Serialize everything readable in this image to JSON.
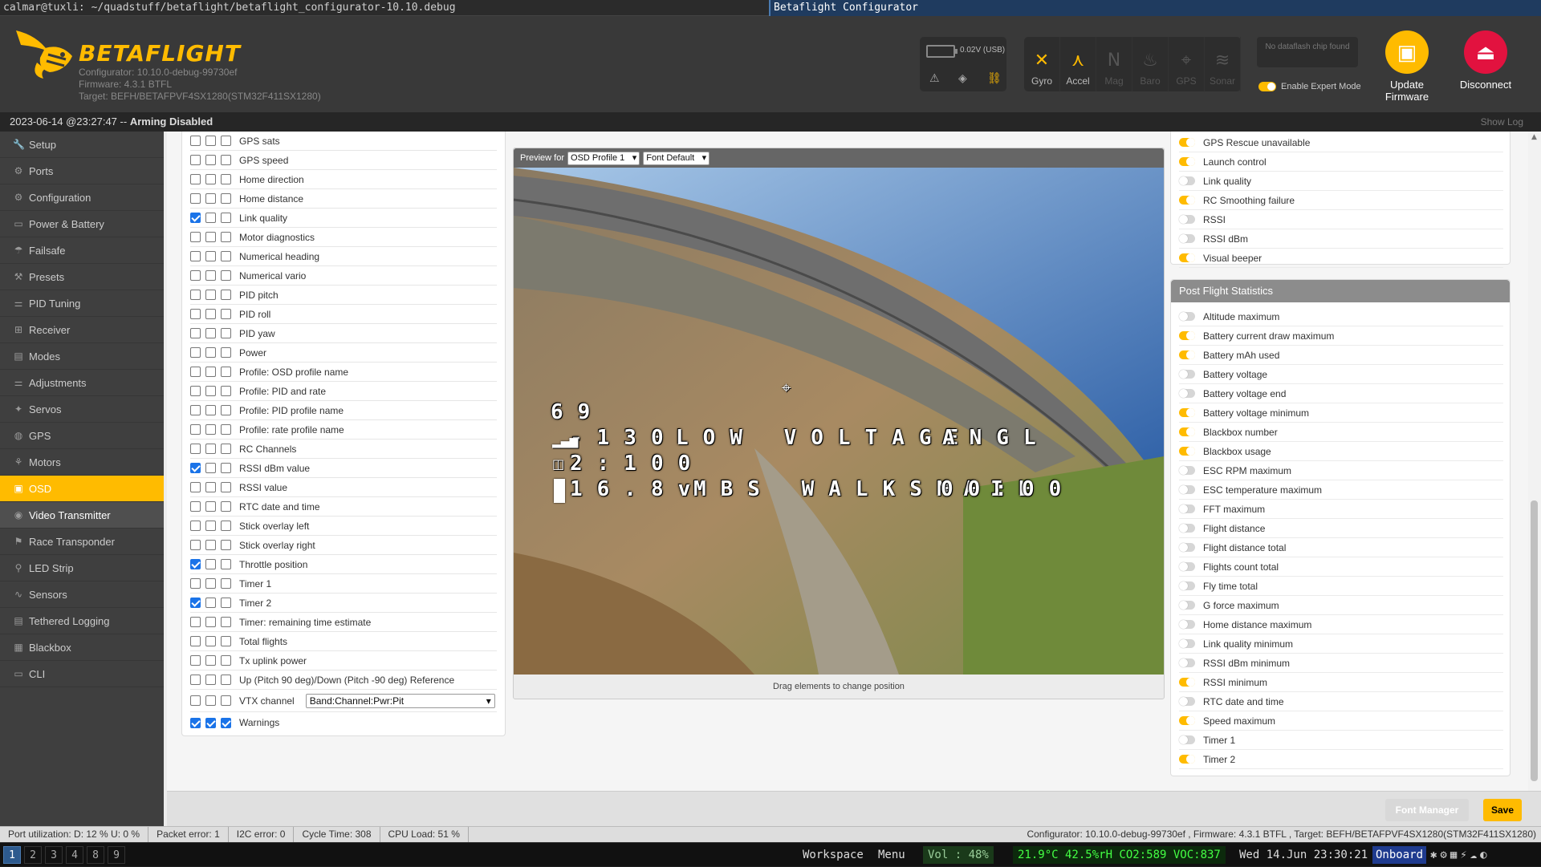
{
  "window": {
    "terminal_title": "calmar@tuxli: ~/quadstuff/betaflight/betaflight_configurator-10.10.debug",
    "app_title": "Betaflight Configurator"
  },
  "header": {
    "brand": "BETAFLIGHT",
    "configurator_version": "Configurator: 10.10.0-debug-99730ef",
    "firmware": "Firmware: 4.3.1 BTFL",
    "target": "Target: BEFH/BETAFPVF4SX1280(STM32F411SX1280)",
    "battery_voltage": "0.02V (USB)",
    "sensors": [
      {
        "label": "Gyro",
        "icon": "gyro-icon",
        "active": true
      },
      {
        "label": "Accel",
        "icon": "accel-icon",
        "active": true
      },
      {
        "label": "Mag",
        "icon": "mag-icon",
        "active": false
      },
      {
        "label": "Baro",
        "icon": "baro-icon",
        "active": false
      },
      {
        "label": "GPS",
        "icon": "gps-icon",
        "active": false
      },
      {
        "label": "Sonar",
        "icon": "sonar-icon",
        "active": false
      }
    ],
    "dataflash": "No dataflash chip found",
    "expert_mode_label": "Enable Expert Mode",
    "expert_mode": true,
    "update_firmware": "Update Firmware",
    "disconnect": "Disconnect"
  },
  "status_top": {
    "timestamp": "2023-06-14 @23:27:47",
    "separator": "--",
    "state": "Arming Disabled",
    "show_log": "Show Log"
  },
  "nav": [
    {
      "label": "Setup",
      "icon": "wrench-icon"
    },
    {
      "label": "Ports",
      "icon": "plug-icon"
    },
    {
      "label": "Configuration",
      "icon": "gear-icon"
    },
    {
      "label": "Power & Battery",
      "icon": "battery-icon"
    },
    {
      "label": "Failsafe",
      "icon": "parachute-icon"
    },
    {
      "label": "Presets",
      "icon": "presets-icon"
    },
    {
      "label": "PID Tuning",
      "icon": "pid-icon"
    },
    {
      "label": "Receiver",
      "icon": "receiver-icon"
    },
    {
      "label": "Modes",
      "icon": "modes-icon"
    },
    {
      "label": "Adjustments",
      "icon": "sliders-icon"
    },
    {
      "label": "Servos",
      "icon": "servo-icon"
    },
    {
      "label": "GPS",
      "icon": "globe-icon"
    },
    {
      "label": "Motors",
      "icon": "motor-icon"
    },
    {
      "label": "OSD",
      "icon": "osd-icon"
    },
    {
      "label": "Video Transmitter",
      "icon": "antenna-icon"
    },
    {
      "label": "Race Transponder",
      "icon": "transponder-icon"
    },
    {
      "label": "LED Strip",
      "icon": "led-icon"
    },
    {
      "label": "Sensors",
      "icon": "sensors-icon"
    },
    {
      "label": "Tethered Logging",
      "icon": "logging-icon"
    },
    {
      "label": "Blackbox",
      "icon": "blackbox-icon"
    },
    {
      "label": "CLI",
      "icon": "cli-icon"
    }
  ],
  "nav_active": "OSD",
  "osd_elements": [
    {
      "label": "GPS sats",
      "checks": [
        false,
        false,
        false
      ]
    },
    {
      "label": "GPS speed",
      "checks": [
        false,
        false,
        false
      ]
    },
    {
      "label": "Home direction",
      "checks": [
        false,
        false,
        false
      ]
    },
    {
      "label": "Home distance",
      "checks": [
        false,
        false,
        false
      ]
    },
    {
      "label": "Link quality",
      "checks": [
        true,
        false,
        false
      ]
    },
    {
      "label": "Motor diagnostics",
      "checks": [
        false,
        false,
        false
      ]
    },
    {
      "label": "Numerical heading",
      "checks": [
        false,
        false,
        false
      ]
    },
    {
      "label": "Numerical vario",
      "checks": [
        false,
        false,
        false
      ]
    },
    {
      "label": "PID pitch",
      "checks": [
        false,
        false,
        false
      ]
    },
    {
      "label": "PID roll",
      "checks": [
        false,
        false,
        false
      ]
    },
    {
      "label": "PID yaw",
      "checks": [
        false,
        false,
        false
      ]
    },
    {
      "label": "Power",
      "checks": [
        false,
        false,
        false
      ]
    },
    {
      "label": "Profile: OSD profile name",
      "checks": [
        false,
        false,
        false
      ]
    },
    {
      "label": "Profile: PID and rate",
      "checks": [
        false,
        false,
        false
      ]
    },
    {
      "label": "Profile: PID profile name",
      "checks": [
        false,
        false,
        false
      ]
    },
    {
      "label": "Profile: rate profile name",
      "checks": [
        false,
        false,
        false
      ]
    },
    {
      "label": "RC Channels",
      "checks": [
        false,
        false,
        false
      ]
    },
    {
      "label": "RSSI dBm value",
      "checks": [
        true,
        false,
        false
      ]
    },
    {
      "label": "RSSI value",
      "checks": [
        false,
        false,
        false
      ]
    },
    {
      "label": "RTC date and time",
      "checks": [
        false,
        false,
        false
      ]
    },
    {
      "label": "Stick overlay left",
      "checks": [
        false,
        false,
        false
      ]
    },
    {
      "label": "Stick overlay right",
      "checks": [
        false,
        false,
        false
      ]
    },
    {
      "label": "Throttle position",
      "checks": [
        true,
        false,
        false
      ]
    },
    {
      "label": "Timer 1",
      "checks": [
        false,
        false,
        false
      ]
    },
    {
      "label": "Timer 2",
      "checks": [
        true,
        false,
        false
      ]
    },
    {
      "label": "Timer: remaining time estimate",
      "checks": [
        false,
        false,
        false
      ]
    },
    {
      "label": "Total flights",
      "checks": [
        false,
        false,
        false
      ]
    },
    {
      "label": "Tx uplink power",
      "checks": [
        false,
        false,
        false
      ]
    },
    {
      "label": "Up (Pitch 90 deg)/Down (Pitch -90 deg) Reference",
      "checks": [
        false,
        false,
        false
      ]
    }
  ],
  "vtx_channel": {
    "label": "VTX channel",
    "value": "Band:Channel:Pwr:Pit",
    "checks": [
      false,
      false,
      false
    ]
  },
  "warnings_row": {
    "label": "Warnings",
    "checks": [
      true,
      true,
      true
    ]
  },
  "preview": {
    "label": "Preview for",
    "profile": "OSD Profile 1",
    "font": "Font Default",
    "footer": "Drag elements to change position",
    "osd": {
      "sats": "69",
      "rssi": "-130",
      "warning": "LOW VOLTAGE",
      "angl": "ANGL",
      "timer": "2:100",
      "voltage": "16.8v",
      "craft": "MBS WALKSNAIL",
      "flytime": "00:00"
    }
  },
  "warnings_list": [
    {
      "label": "GPS Rescue unavailable",
      "on": true
    },
    {
      "label": "Launch control",
      "on": true
    },
    {
      "label": "Link quality",
      "on": false
    },
    {
      "label": "RC Smoothing failure",
      "on": true
    },
    {
      "label": "RSSI",
      "on": false
    },
    {
      "label": "RSSI dBm",
      "on": false
    },
    {
      "label": "Visual beeper",
      "on": true
    }
  ],
  "post_flight": {
    "title": "Post Flight Statistics",
    "items": [
      {
        "label": "Altitude maximum",
        "on": false
      },
      {
        "label": "Battery current draw maximum",
        "on": true
      },
      {
        "label": "Battery mAh used",
        "on": true
      },
      {
        "label": "Battery voltage",
        "on": false
      },
      {
        "label": "Battery voltage end",
        "on": false
      },
      {
        "label": "Battery voltage minimum",
        "on": true
      },
      {
        "label": "Blackbox number",
        "on": true
      },
      {
        "label": "Blackbox usage",
        "on": true
      },
      {
        "label": "ESC RPM maximum",
        "on": false
      },
      {
        "label": "ESC temperature maximum",
        "on": false
      },
      {
        "label": "FFT maximum",
        "on": false
      },
      {
        "label": "Flight distance",
        "on": false
      },
      {
        "label": "Flight distance total",
        "on": false
      },
      {
        "label": "Flights count total",
        "on": false
      },
      {
        "label": "Fly time total",
        "on": false
      },
      {
        "label": "G force maximum",
        "on": false
      },
      {
        "label": "Home distance maximum",
        "on": false
      },
      {
        "label": "Link quality minimum",
        "on": false
      },
      {
        "label": "RSSI dBm minimum",
        "on": false
      },
      {
        "label": "RSSI minimum",
        "on": true
      },
      {
        "label": "RTC date and time",
        "on": false
      },
      {
        "label": "Speed maximum",
        "on": true
      },
      {
        "label": "Timer 1",
        "on": false
      },
      {
        "label": "Timer 2",
        "on": true
      }
    ]
  },
  "buttons": {
    "font_manager": "Font Manager",
    "save": "Save"
  },
  "app_status": {
    "port": "Port utilization: D: 12 % U: 0 %",
    "packet": "Packet error: 1",
    "i2c": "I2C error: 0",
    "cycle": "Cycle Time: 308",
    "cpu": "CPU Load: 51 %",
    "right": "Configurator: 10.10.0-debug-99730ef , Firmware: 4.3.1 BTFL , Target: BEFH/BETAFPVF4SX1280(STM32F411SX1280)"
  },
  "taskbar": {
    "workspaces": [
      "1",
      "2",
      "3",
      "4",
      "8",
      "9"
    ],
    "current": "1",
    "workspace_label": "Workspace",
    "menu_label": "Menu",
    "volume": "Vol : 48%",
    "env": "21.9°C 42.5%rH CO2:589 VOC:837",
    "datetime": "Wed 14.Jun 23:30:21",
    "audio": "Onboard"
  },
  "colors": {
    "accent": "#ffbb00",
    "sidebar": "#3f3f3f",
    "header": "#393939",
    "disconnect": "#e2123f"
  }
}
